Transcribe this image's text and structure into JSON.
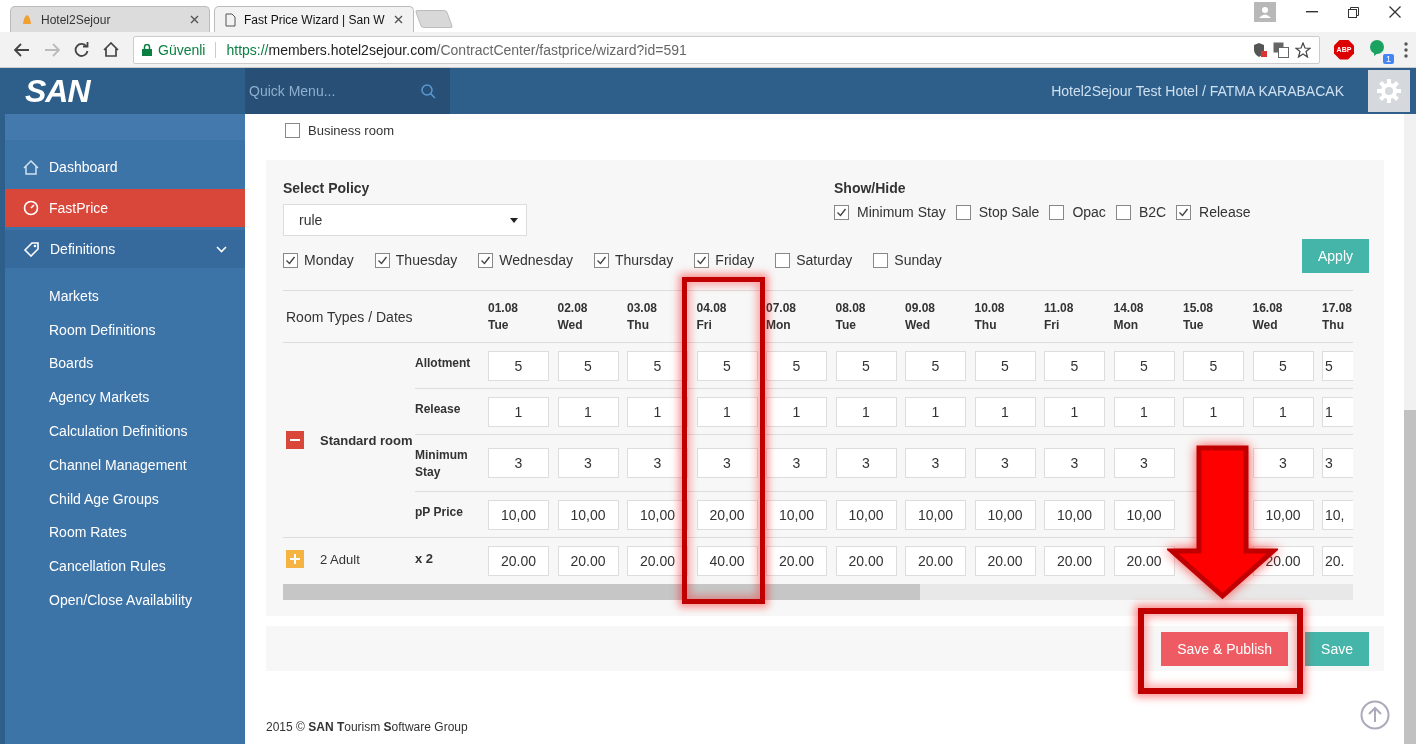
{
  "browser": {
    "tabs": [
      {
        "title": "Hotel2Sejour",
        "selected": false
      },
      {
        "title": "Fast Price Wizard | San W",
        "selected": true
      }
    ],
    "url": {
      "secure_label": "Güvenli",
      "scheme": "https://",
      "host": "members.hotel2sejour.com",
      "path": "/ContractCenter/fastprice/wizard?id=591"
    },
    "adblock_label": "ABP",
    "extension_badge": "1"
  },
  "header": {
    "logo": "SAN",
    "quick_menu_placeholder": "Quick Menu...",
    "user": "Hotel2Sejour Test Hotel / FATMA KARABACAK"
  },
  "sidebar": {
    "items": [
      {
        "label": "Dashboard",
        "selected": false
      },
      {
        "label": "FastPrice",
        "selected": true
      },
      {
        "label": "Definitions",
        "selected": false,
        "expanded": true,
        "children": [
          {
            "label": "Markets",
            "selected": false
          },
          {
            "label": "Room Definitions",
            "selected": false
          },
          {
            "label": "Boards",
            "selected": false
          },
          {
            "label": "Agency Markets",
            "selected": false
          },
          {
            "label": "Calculation Definitions",
            "selected": false
          },
          {
            "label": "Channel Management",
            "selected": false
          },
          {
            "label": "Child Age Groups",
            "selected": false
          },
          {
            "label": "Room Rates",
            "selected": false
          },
          {
            "label": "Cancellation Rules",
            "selected": false
          },
          {
            "label": "Open/Close Availability",
            "selected": false
          }
        ]
      }
    ]
  },
  "room_filter": {
    "label": "Business room",
    "checked": false
  },
  "policy": {
    "label": "Select Policy",
    "value": "rule"
  },
  "show_hide": {
    "label": "Show/Hide",
    "options": [
      {
        "label": "Minimum Stay",
        "checked": true
      },
      {
        "label": "Stop Sale",
        "checked": false
      },
      {
        "label": "Opac",
        "checked": false
      },
      {
        "label": "B2C",
        "checked": false
      },
      {
        "label": "Release",
        "checked": true
      }
    ]
  },
  "days": [
    {
      "label": "Monday",
      "checked": true
    },
    {
      "label": "Thuesday",
      "checked": true
    },
    {
      "label": "Wednesday",
      "checked": true
    },
    {
      "label": "Thursday",
      "checked": true
    },
    {
      "label": "Friday",
      "checked": true
    },
    {
      "label": "Saturday",
      "checked": false
    },
    {
      "label": "Sunday",
      "checked": false
    }
  ],
  "apply_button": "Apply",
  "table": {
    "header": "Room Types / Dates",
    "dates": [
      {
        "date": "01.08",
        "day": "Tue",
        "highlighted": false
      },
      {
        "date": "02.08",
        "day": "Wed",
        "highlighted": false
      },
      {
        "date": "03.08",
        "day": "Thu",
        "highlighted": false
      },
      {
        "date": "04.08",
        "day": "Fri",
        "highlighted": true
      },
      {
        "date": "07.08",
        "day": "Mon",
        "highlighted": false
      },
      {
        "date": "08.08",
        "day": "Tue",
        "highlighted": false
      },
      {
        "date": "09.08",
        "day": "Wed",
        "highlighted": false
      },
      {
        "date": "10.08",
        "day": "Thu",
        "highlighted": false
      },
      {
        "date": "11.08",
        "day": "Fri",
        "highlighted": false
      },
      {
        "date": "14.08",
        "day": "Mon",
        "highlighted": false
      },
      {
        "date": "15.08",
        "day": "Tue",
        "highlighted": false
      },
      {
        "date": "16.08",
        "day": "Wed",
        "highlighted": false
      },
      {
        "date": "17.08",
        "day": "Thu",
        "highlighted": false
      }
    ],
    "rooms": [
      {
        "name": "Standard room",
        "expanded": true,
        "rows": [
          {
            "label": "Allotment",
            "cells": [
              {
                "value": "5"
              },
              {
                "value": "5"
              },
              {
                "value": "5"
              },
              {
                "value": "5"
              },
              {
                "value": "5"
              },
              {
                "value": "5"
              },
              {
                "value": "5"
              },
              {
                "value": "5"
              },
              {
                "value": "5"
              },
              {
                "value": "5"
              },
              {
                "value": "5"
              },
              {
                "value": "5"
              },
              {
                "value": "5"
              }
            ]
          },
          {
            "label": "Release",
            "cells": [
              {
                "value": "1"
              },
              {
                "value": "1"
              },
              {
                "value": "1"
              },
              {
                "value": "1"
              },
              {
                "value": "1"
              },
              {
                "value": "1"
              },
              {
                "value": "1"
              },
              {
                "value": "1"
              },
              {
                "value": "1"
              },
              {
                "value": "1"
              },
              {
                "value": "1"
              },
              {
                "value": "1"
              },
              {
                "value": "1"
              }
            ]
          },
          {
            "label": "Minimum Stay",
            "cells": [
              {
                "value": "3"
              },
              {
                "value": "3"
              },
              {
                "value": "3"
              },
              {
                "value": "3"
              },
              {
                "value": "3"
              },
              {
                "value": "3"
              },
              {
                "value": "3"
              },
              {
                "value": "3"
              },
              {
                "value": "3"
              },
              {
                "value": "3"
              },
              {
                "covered": true
              },
              {
                "value": "3"
              },
              {
                "value": "3"
              }
            ]
          },
          {
            "label": "pP Price",
            "cells": [
              {
                "value": "10,00"
              },
              {
                "value": "10,00"
              },
              {
                "value": "10,00"
              },
              {
                "value": "20,00"
              },
              {
                "value": "10,00"
              },
              {
                "value": "10,00"
              },
              {
                "value": "10,00"
              },
              {
                "value": "10,00"
              },
              {
                "value": "10,00"
              },
              {
                "value": "10,00"
              },
              {
                "covered": true
              },
              {
                "value": "10,00"
              },
              {
                "value": "10,"
              }
            ]
          }
        ]
      }
    ],
    "occupancies": [
      {
        "label": "2 Adult",
        "multiplier": "x 2",
        "expanded": false,
        "cells": [
          {
            "value": "20.00"
          },
          {
            "value": "20.00"
          },
          {
            "value": "20.00"
          },
          {
            "value": "40.00"
          },
          {
            "value": "20.00"
          },
          {
            "value": "20.00"
          },
          {
            "value": "20.00"
          },
          {
            "value": "20.00"
          },
          {
            "value": "20.00"
          },
          {
            "value": "20.00"
          },
          {
            "covered": true
          },
          {
            "value": "20.00"
          },
          {
            "value": "20."
          }
        ]
      }
    ]
  },
  "buttons": [
    {
      "label": "Save & Publish",
      "kind": "danger",
      "highlighted": true
    },
    {
      "label": "Save",
      "kind": "success",
      "highlighted": false
    }
  ],
  "footer": "2015 © **SAN** **T**ourism **S**oftware Group"
}
